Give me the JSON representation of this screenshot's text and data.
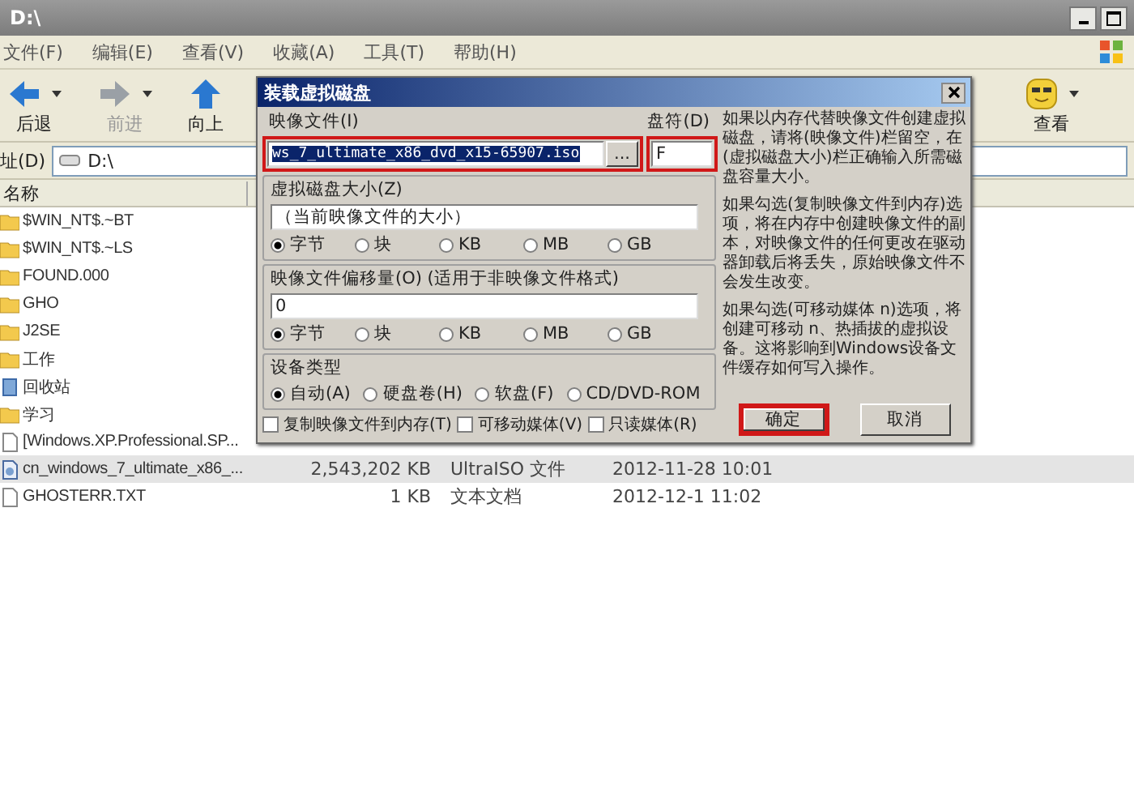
{
  "window": {
    "title": "D:\\"
  },
  "menu": [
    "文件(F)",
    "编辑(E)",
    "查看(V)",
    "收藏(A)",
    "工具(T)",
    "帮助(H)"
  ],
  "toolbar": [
    {
      "kind": "back",
      "label": "后退",
      "disabled": false
    },
    {
      "kind": "forward",
      "label": "前进",
      "disabled": true
    },
    {
      "kind": "up",
      "label": "向上",
      "disabled": false
    },
    {
      "kind": "view",
      "label": "查看",
      "disabled": false
    }
  ],
  "address": {
    "label": "址(D)",
    "value": "D:\\"
  },
  "file_list": {
    "columns": [
      "名称"
    ],
    "rows": [
      {
        "kind": "folder",
        "name": "$WIN_NT$.~BT",
        "selected": false
      },
      {
        "kind": "folder",
        "name": "$WIN_NT$.~LS",
        "selected": false
      },
      {
        "kind": "folder",
        "name": "FOUND.000",
        "selected": false
      },
      {
        "kind": "folder",
        "name": "GHO",
        "selected": false
      },
      {
        "kind": "folder",
        "name": "J2SE",
        "selected": false
      },
      {
        "kind": "folder",
        "name": "工作",
        "selected": false
      },
      {
        "kind": "recycle",
        "name": "回收站",
        "selected": false
      },
      {
        "kind": "folder",
        "name": "学习",
        "selected": false
      },
      {
        "kind": "file",
        "name": "[Windows.XP.Professional.SP...",
        "selected": false
      },
      {
        "kind": "disc",
        "name": "cn_windows_7_ultimate_x86_...",
        "size": "2,543,202 KB",
        "type": "UltraISO 文件",
        "modified": "2012-11-28 10:01",
        "selected": true
      },
      {
        "kind": "file",
        "name": "GHOSTERR.TXT",
        "size": "1 KB",
        "type": "文本文档",
        "modified": "2012-12-1 11:02",
        "selected": false
      }
    ]
  },
  "dialog": {
    "title": "装载虚拟磁盘",
    "image_file": {
      "label": "映像文件(I)",
      "value": "ws_7_ultimate_x86_dvd_x15-65907.iso",
      "browse": "...",
      "highlighted": true
    },
    "drive_letter": {
      "label": "盘符(D)",
      "value": "F",
      "highlighted": true
    },
    "groups": [
      {
        "title": "虚拟磁盘大小(Z)",
        "value": "（当前映像文件的大小）",
        "options": [
          {
            "label": "字节",
            "selected": true
          },
          {
            "label": "块",
            "selected": false
          },
          {
            "label": "KB",
            "selected": false
          },
          {
            "label": "MB",
            "selected": false
          },
          {
            "label": "GB",
            "selected": false
          }
        ]
      },
      {
        "title": "映像文件偏移量(O) (适用于非映像文件格式)",
        "value": "0",
        "options": [
          {
            "label": "字节",
            "selected": true
          },
          {
            "label": "块",
            "selected": false
          },
          {
            "label": "KB",
            "selected": false
          },
          {
            "label": "MB",
            "selected": false
          },
          {
            "label": "GB",
            "selected": false
          }
        ]
      },
      {
        "title": "设备类型",
        "options": [
          {
            "label": "自动(A)",
            "selected": true
          },
          {
            "label": "硬盘卷(H)",
            "selected": false
          },
          {
            "label": "软盘(F)",
            "selected": false
          },
          {
            "label": "CD/DVD-ROM",
            "selected": false
          }
        ]
      }
    ],
    "checkboxes": [
      {
        "label": "复制映像文件到内存(T)",
        "checked": false
      },
      {
        "label": "可移动媒体(V)",
        "checked": false
      },
      {
        "label": "只读媒体(R)",
        "checked": false
      }
    ],
    "help": [
      "如果以内存代替映像文件创建虚拟磁盘，请将(映像文件)栏留空，在(虚拟磁盘大小)栏正确输入所需磁盘容量大小。",
      "如果勾选(复制映像文件到内存)选项，将在内存中创建映像文件的副本，对映像文件的任何更改在驱动器卸载后将丢失，原始映像文件不会发生改变。",
      "如果勾选(可移动媒体 n)选项，将创建可移动 n、热插拔的虚拟设备。这将影响到Windows设备文件缓存如何写入操作。"
    ],
    "buttons": [
      {
        "label": "确定",
        "highlighted": true
      },
      {
        "label": "取消",
        "highlighted": false
      }
    ]
  }
}
